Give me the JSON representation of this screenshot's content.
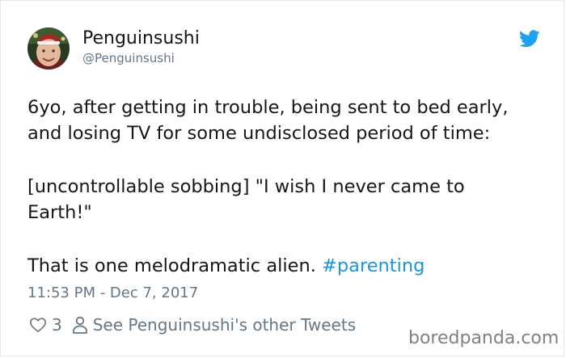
{
  "author": {
    "display_name": "Penguinsushi",
    "handle": "@Penguinsushi"
  },
  "tweet": {
    "line1": "6yo, after getting in trouble, being sent to bed early,",
    "line2": "and losing TV for some undisclosed period of time:",
    "line3": "[uncontrollable sobbing] \"I wish I never came to",
    "line4": "Earth!\"",
    "line5_text": "That is one melodramatic alien. ",
    "hashtag": "#parenting"
  },
  "timestamp": "11:53 PM - Dec 7, 2017",
  "actions": {
    "like_count": "3",
    "other_tweets_link": "See Penguinsushi's other Tweets"
  },
  "watermark": "boredpanda.com",
  "colors": {
    "link": "#1b95e0",
    "secondary_text": "#657786",
    "twitter_blue": "#1da1f2"
  },
  "icons": [
    "avatar-photo",
    "twitter-bird-icon",
    "heart-icon",
    "person-icon"
  ]
}
